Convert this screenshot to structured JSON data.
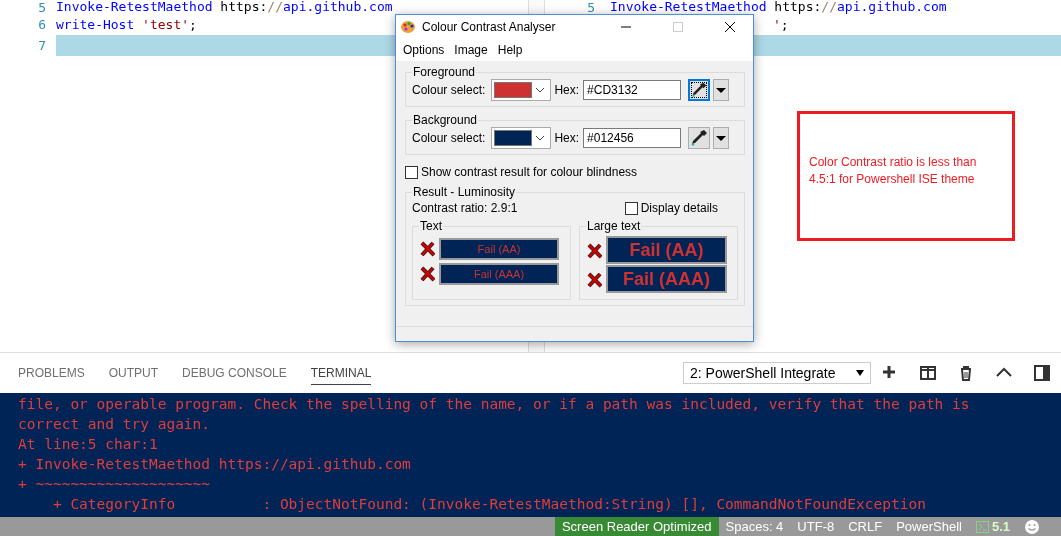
{
  "editor": {
    "panes": [
      {
        "lines": [
          {
            "number": "5",
            "tokens": [
              {
                "text": "Invoke-RetestMaethod",
                "kind": "command"
              },
              {
                "text": " https:",
                "kind": "plain"
              },
              {
                "text": "//",
                "kind": "comment"
              },
              {
                "text": "api.github.com",
                "kind": "command"
              }
            ],
            "current": false
          },
          {
            "number": "6",
            "tokens": [
              {
                "text": "write-Host",
                "kind": "command"
              },
              {
                "text": " 'test'",
                "kind": "string"
              },
              {
                "text": ";",
                "kind": "plain"
              }
            ],
            "current": false
          },
          {
            "number": "7",
            "current": true
          }
        ]
      },
      {
        "lines": [
          {
            "number": "5",
            "tokens": [
              {
                "text": "Invoke-RetestMaethod",
                "kind": "command"
              },
              {
                "text": " https:",
                "kind": "plain"
              },
              {
                "text": "//",
                "kind": "comment"
              },
              {
                "text": "api.github.com",
                "kind": "command"
              }
            ],
            "current": false
          },
          {
            "tokens": [
              {
                "text": "'",
                "kind": "string"
              },
              {
                "text": ";",
                "kind": "plain"
              }
            ],
            "current": false
          },
          {
            "current": true
          }
        ]
      }
    ]
  },
  "dialog": {
    "title": "Colour Contrast Analyser",
    "menu": [
      "Options",
      "Image",
      "Help"
    ],
    "colours": [
      {
        "legend": "Foreground",
        "label": "Colour select:",
        "color": "#cd3132",
        "hex_label": "Hex:",
        "hex": "#CD3132",
        "picker_focused": true
      },
      {
        "legend": "Background",
        "label": "Colour select:",
        "color": "#012456",
        "hex_label": "Hex:",
        "hex": "#012456",
        "picker_focused": false
      }
    ],
    "colour_blindness": {
      "label": "Show contrast result for colour blindness",
      "checked": false
    },
    "result": {
      "legend": "Result - Luminosity",
      "ratio": "Contrast ratio: 2.9:1",
      "details": {
        "label": "Display details",
        "checked": false
      },
      "groups": [
        {
          "kind": "normal",
          "legend": "Text",
          "rows": [
            {
              "label": "Fail (AA)",
              "passed": false
            },
            {
              "label": "Fail (AAA)",
              "passed": false
            }
          ]
        },
        {
          "kind": "large",
          "legend": "Large text",
          "rows": [
            {
              "label": "Fail (AA)",
              "passed": false
            },
            {
              "label": "Fail (AAA)",
              "passed": false
            }
          ]
        }
      ]
    }
  },
  "note": {
    "text": "Color Contrast ratio is less than 4.5:1 for Powershell ISE theme"
  },
  "panel": {
    "tabs": [
      {
        "label": "PROBLEMS",
        "selected": false
      },
      {
        "label": "OUTPUT",
        "selected": false
      },
      {
        "label": "DEBUG CONSOLE",
        "selected": false
      },
      {
        "label": "TERMINAL",
        "selected": true
      }
    ],
    "terminal_select": "2: PowerShell Integrate",
    "terminal_lines": [
      "file, or operable program. Check the spelling of the name, or if a path was included, verify that the path is",
      "correct and try again.",
      "At line:5 char:1",
      "+ Invoke-RetestMaethod https://api.github.com",
      "+ ~~~~~~~~~~~~~~~~~~~~",
      "    + CategoryInfo          : ObjectNotFound: (Invoke-RetestMaethod:String) [], CommandNotFoundException"
    ]
  },
  "status_bar": [
    {
      "kind": "highlight",
      "text": "Screen Reader Optimized"
    },
    {
      "kind": "plain",
      "text": "Spaces: 4"
    },
    {
      "kind": "plain",
      "text": "UTF-8"
    },
    {
      "kind": "plain",
      "text": "CRLF"
    },
    {
      "kind": "plain",
      "text": "PowerShell"
    },
    {
      "kind": "version",
      "text": "5.1"
    },
    {
      "kind": "feedback"
    }
  ]
}
